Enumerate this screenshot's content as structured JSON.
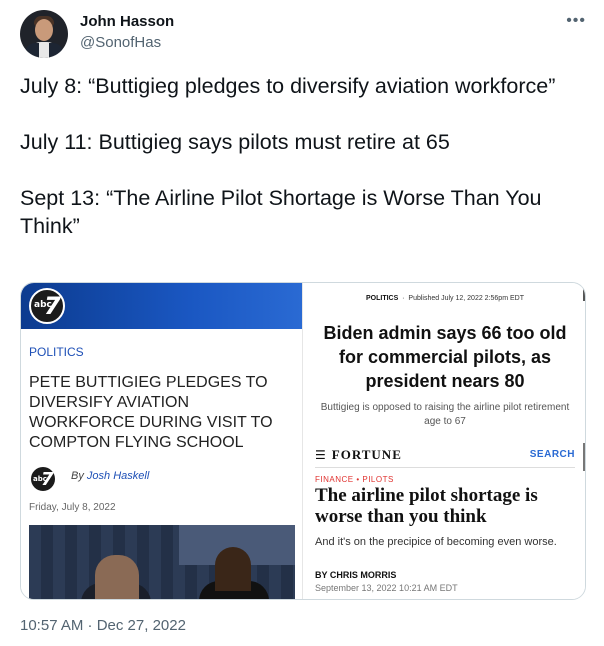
{
  "author": {
    "name": "John Hasson",
    "handle": "@SonofHas"
  },
  "more_icon": "more-horizontal-icon",
  "tweet": {
    "lines": [
      "July 8: “Buttigieg pledges to diversify aviation workforce”",
      "July 11: Buttigieg says pilots must retire at 65",
      "Sept 13: “The Airline Pilot Shortage is Worse Than You Think”"
    ]
  },
  "media": {
    "left": {
      "logo_small": "abc",
      "logo_number": "7",
      "section": "POLITICS",
      "headline": "PETE BUTTIGIEG PLEDGES TO DIVERSIFY AVIATION WORKFORCE DURING VISIT TO COMPTON FLYING SCHOOL",
      "by_prefix": "By",
      "author": "Josh Haskell",
      "date": "Friday, July 8, 2022"
    },
    "right": {
      "section": "POLITICS",
      "published": "Published July 12, 2022 2:56pm EDT",
      "headline": "Biden admin says 66 too old for commercial pilots, as president nears 80",
      "subhead": "Buttigieg is opposed to raising the airline pilot retirement age to 67",
      "brand": "FORTUNE",
      "search": "SEARCH",
      "kicker": "FINANCE • PILOTS",
      "fortune_headline": "The airline pilot shortage is worse than you think",
      "dek": "And it's on the precipice of becoming even worse.",
      "byline": "BY CHRIS MORRIS",
      "date": "September 13, 2022 10:21 AM EDT"
    }
  },
  "timestamp": "10:57 AM · Dec 27, 2022",
  "colors": {
    "abc_blue": "#1a57c2",
    "link_blue": "#1d4fb6",
    "fortune_red": "#e0322f",
    "muted_text": "#536471"
  }
}
